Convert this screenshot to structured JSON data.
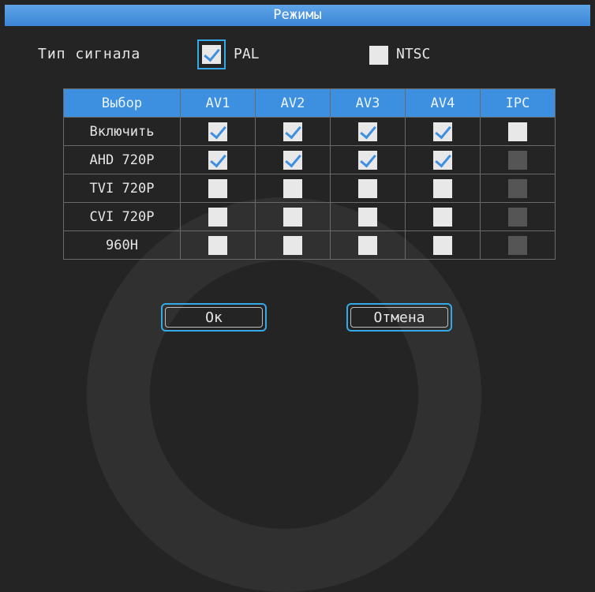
{
  "title": "Режимы",
  "signal": {
    "label": "Тип сигнала",
    "options": [
      {
        "label": "PAL",
        "checked": true,
        "focused": true
      },
      {
        "label": "NTSC",
        "checked": false,
        "focused": false
      }
    ]
  },
  "table": {
    "header_label": "Выбор",
    "columns": [
      "AV1",
      "AV2",
      "AV3",
      "AV4",
      "IPC"
    ],
    "rows": [
      {
        "label": "Включить",
        "cells": [
          "checked",
          "checked",
          "checked",
          "checked",
          "on"
        ]
      },
      {
        "label": "AHD 720P",
        "cells": [
          "checked",
          "checked",
          "checked",
          "checked",
          "dis"
        ]
      },
      {
        "label": "TVI 720P",
        "cells": [
          "on",
          "on",
          "on",
          "on",
          "dis"
        ]
      },
      {
        "label": "CVI 720P",
        "cells": [
          "on",
          "on",
          "on",
          "on",
          "dis"
        ]
      },
      {
        "label": "960H",
        "cells": [
          "on",
          "on",
          "on",
          "on",
          "dis"
        ]
      }
    ]
  },
  "buttons": {
    "ok": "Ок",
    "cancel": "Отмена"
  },
  "colors": {
    "accent": "#3d8fe0",
    "focus": "#35a8e8",
    "background": "#242424"
  }
}
